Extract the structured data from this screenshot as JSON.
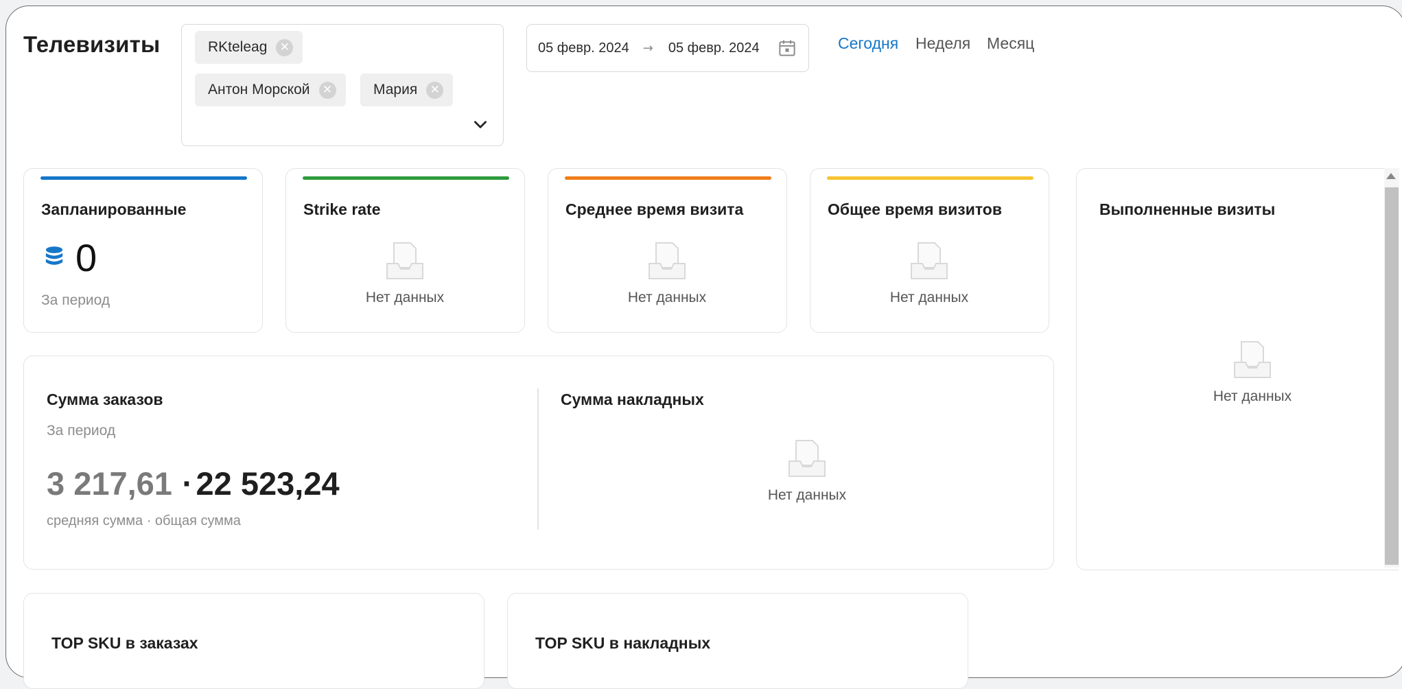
{
  "header": {
    "title": "Телевизиты"
  },
  "filter": {
    "tags": [
      {
        "label": "RKteleag"
      },
      {
        "label": "Антон Морской"
      },
      {
        "label": "Мария"
      }
    ]
  },
  "date_range": {
    "start": "05 февр. 2024",
    "separator": "→",
    "end": "05 февр. 2024"
  },
  "periods": [
    {
      "label": "Сегодня",
      "active": true
    },
    {
      "label": "Неделя",
      "active": false
    },
    {
      "label": "Месяц",
      "active": false
    }
  ],
  "kpis": [
    {
      "title": "Запланированные",
      "accent": "#1677c8",
      "value": "0",
      "sub": "За период",
      "icon": "database-icon"
    },
    {
      "title": "Strike rate",
      "accent": "#2f9a3c",
      "empty": "Нет данных"
    },
    {
      "title": "Среднее время визита",
      "accent": "#f07d1a",
      "empty": "Нет данных"
    },
    {
      "title": "Общее время визитов",
      "accent": "#f5c431",
      "empty": "Нет данных"
    }
  ],
  "orders": {
    "title": "Сумма заказов",
    "sub": "За период",
    "avg": "3 217,61",
    "total_prefix": "·",
    "total": "22 523,24",
    "caption": "средняя сумма · общая сумма"
  },
  "invoices": {
    "title": "Сумма накладных",
    "empty": "Нет данных"
  },
  "completed": {
    "title": "Выполненные визиты",
    "empty": "Нет данных"
  },
  "top_orders": {
    "title": "TOP SKU в заказах"
  },
  "top_invoices": {
    "title": "TOP SKU в накладных"
  }
}
